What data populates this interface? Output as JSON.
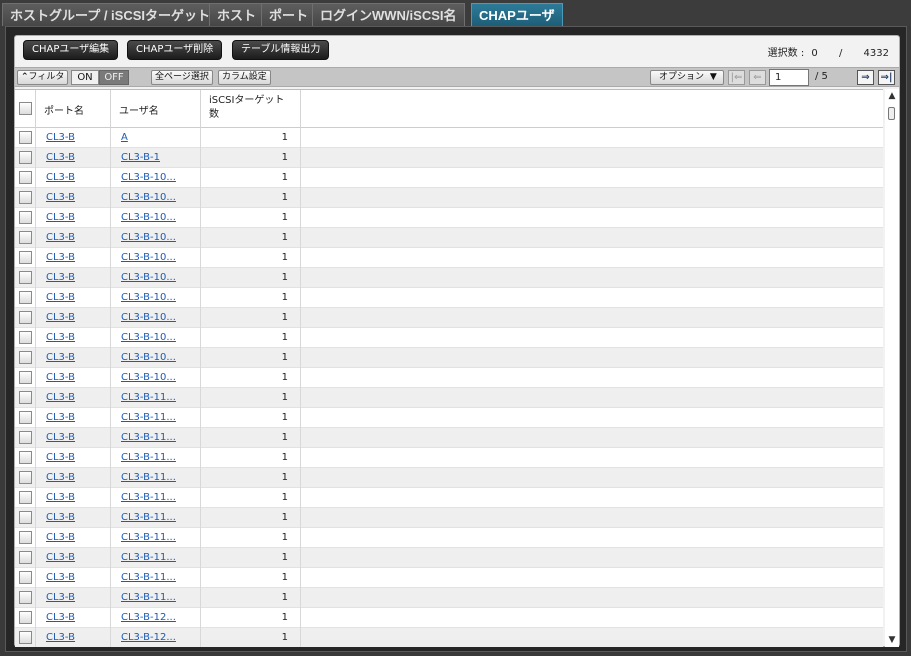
{
  "tabs": [
    {
      "label": "ホストグループ / iSCSIターゲット",
      "active": false
    },
    {
      "label": "ホスト",
      "active": false
    },
    {
      "label": "ポート",
      "active": false
    },
    {
      "label": "ログインWWN/iSCSI名",
      "active": false
    },
    {
      "label": "CHAPユーザ",
      "active": true
    }
  ],
  "actions": {
    "edit": "CHAPユーザ編集",
    "delete": "CHAPユーザ削除",
    "export": "テーブル情報出力"
  },
  "selection": {
    "label": "選択数 :",
    "count": "0",
    "separator": "/",
    "total": "4332"
  },
  "toolbar": {
    "filter": "フィルタ",
    "on": "ON",
    "off": "OFF",
    "select_all": "全ページ選択",
    "column_settings": "カラム設定",
    "options": "オプション",
    "page": "1",
    "page_total": "/ 5"
  },
  "table": {
    "columns": [
      "ポート名",
      "ユーザ名",
      "iSCSIターゲット数"
    ],
    "rows": [
      {
        "port": "CL3-B",
        "user": "A",
        "count": "1"
      },
      {
        "port": "CL3-B",
        "user": "CL3-B-1",
        "count": "1"
      },
      {
        "port": "CL3-B",
        "user": "CL3-B-10...",
        "count": "1"
      },
      {
        "port": "CL3-B",
        "user": "CL3-B-10...",
        "count": "1"
      },
      {
        "port": "CL3-B",
        "user": "CL3-B-10...",
        "count": "1"
      },
      {
        "port": "CL3-B",
        "user": "CL3-B-10...",
        "count": "1"
      },
      {
        "port": "CL3-B",
        "user": "CL3-B-10...",
        "count": "1"
      },
      {
        "port": "CL3-B",
        "user": "CL3-B-10...",
        "count": "1"
      },
      {
        "port": "CL3-B",
        "user": "CL3-B-10...",
        "count": "1"
      },
      {
        "port": "CL3-B",
        "user": "CL3-B-10...",
        "count": "1"
      },
      {
        "port": "CL3-B",
        "user": "CL3-B-10...",
        "count": "1"
      },
      {
        "port": "CL3-B",
        "user": "CL3-B-10...",
        "count": "1"
      },
      {
        "port": "CL3-B",
        "user": "CL3-B-10...",
        "count": "1"
      },
      {
        "port": "CL3-B",
        "user": "CL3-B-11...",
        "count": "1"
      },
      {
        "port": "CL3-B",
        "user": "CL3-B-11...",
        "count": "1"
      },
      {
        "port": "CL3-B",
        "user": "CL3-B-11...",
        "count": "1"
      },
      {
        "port": "CL3-B",
        "user": "CL3-B-11...",
        "count": "1"
      },
      {
        "port": "CL3-B",
        "user": "CL3-B-11...",
        "count": "1"
      },
      {
        "port": "CL3-B",
        "user": "CL3-B-11...",
        "count": "1"
      },
      {
        "port": "CL3-B",
        "user": "CL3-B-11...",
        "count": "1"
      },
      {
        "port": "CL3-B",
        "user": "CL3-B-11...",
        "count": "1"
      },
      {
        "port": "CL3-B",
        "user": "CL3-B-11...",
        "count": "1"
      },
      {
        "port": "CL3-B",
        "user": "CL3-B-11...",
        "count": "1"
      },
      {
        "port": "CL3-B",
        "user": "CL3-B-11...",
        "count": "1"
      },
      {
        "port": "CL3-B",
        "user": "CL3-B-12...",
        "count": "1"
      },
      {
        "port": "CL3-B",
        "user": "CL3-B-12...",
        "count": "1"
      }
    ]
  }
}
